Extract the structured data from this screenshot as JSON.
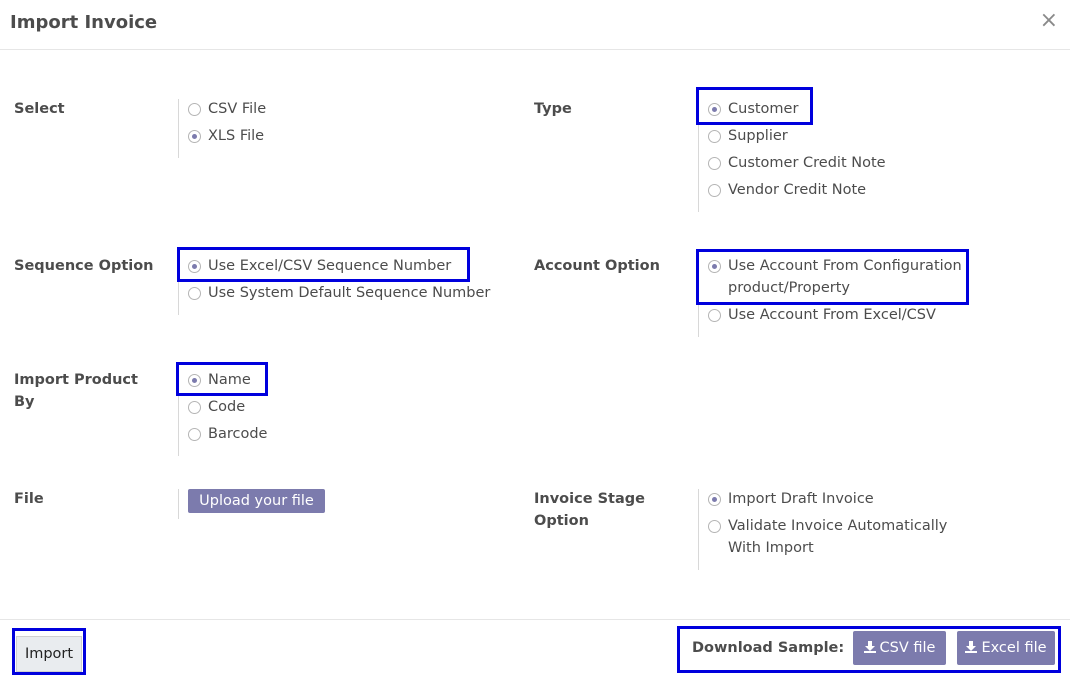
{
  "dialog": {
    "title": "Import Invoice",
    "close_glyph": "×"
  },
  "select": {
    "label": "Select",
    "options": [
      {
        "label": "CSV File",
        "checked": false
      },
      {
        "label": "XLS File",
        "checked": true
      }
    ]
  },
  "type": {
    "label": "Type",
    "options": [
      {
        "label": "Customer",
        "checked": true
      },
      {
        "label": "Supplier",
        "checked": false
      },
      {
        "label": "Customer Credit Note",
        "checked": false
      },
      {
        "label": "Vendor Credit Note",
        "checked": false
      }
    ]
  },
  "sequence": {
    "label": "Sequence Option",
    "options": [
      {
        "label": "Use Excel/CSV Sequence Number",
        "checked": true
      },
      {
        "label": "Use System Default Sequence Number",
        "checked": false
      }
    ]
  },
  "account": {
    "label": "Account Option",
    "options": [
      {
        "label": "Use Account From Configuration product/Property",
        "checked": true
      },
      {
        "label": "Use Account From Excel/CSV",
        "checked": false
      }
    ]
  },
  "product": {
    "label": "Import Product By",
    "options": [
      {
        "label": "Name",
        "checked": true
      },
      {
        "label": "Code",
        "checked": false
      },
      {
        "label": "Barcode",
        "checked": false
      }
    ]
  },
  "file": {
    "label": "File",
    "upload_label": "Upload your file"
  },
  "stage": {
    "label": "Invoice Stage Option",
    "options": [
      {
        "label": "Import Draft Invoice",
        "checked": true
      },
      {
        "label": "Validate Invoice Automatically With Import",
        "checked": false
      }
    ]
  },
  "footer": {
    "import_label": "Import",
    "download_label": "Download Sample:",
    "csv_label": "CSV file",
    "excel_label": "Excel file",
    "download_icon": "download-icon"
  },
  "colors": {
    "accent": "#7c7bad",
    "highlight": "#0000dd"
  }
}
